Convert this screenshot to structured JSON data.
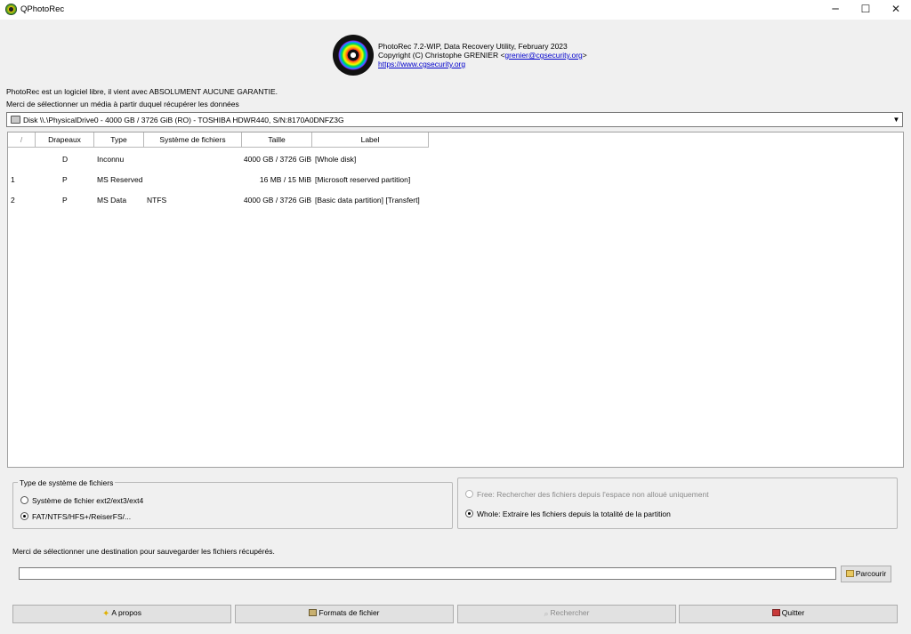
{
  "window": {
    "title": "QPhotoRec",
    "min_glyph": "─",
    "max_glyph": "☐",
    "close_glyph": "✕"
  },
  "header": {
    "version": "PhotoRec 7.2-WIP, Data Recovery Utility, February 2023",
    "copyright_prefix": "Copyright (C) Christophe GRENIER <",
    "email": "grenier@cgsecurity.org",
    "copyright_suffix": ">",
    "url": "https://www.cgsecurity.org"
  },
  "disclaimer": "PhotoRec est un logiciel libre, il vient avec ABSOLUMENT AUCUNE GARANTIE.",
  "select_prompt": "Merci de sélectionner un média à partir duquel récupérer les données",
  "disk_combo": {
    "selected": "Disk \\\\.\\PhysicalDrive0 - 4000 GB / 3726 GiB (RO) - TOSHIBA HDWR440, S/N:8170A0DNFZ3G",
    "arrow": "▼"
  },
  "table": {
    "columns": [
      "/",
      "Drapeaux",
      "Type",
      "Système de fichiers",
      "Taille",
      "Label"
    ],
    "rows": [
      {
        "num": "",
        "flag": "D",
        "type": "Inconnu",
        "fs": "",
        "size": "4000 GB / 3726 GiB",
        "label": "[Whole disk]"
      },
      {
        "num": "1",
        "flag": "P",
        "type": "MS Reserved",
        "fs": "",
        "size": "16 MB / 15 MiB",
        "label": "[Microsoft reserved partition]"
      },
      {
        "num": "2",
        "flag": "P",
        "type": "MS Data",
        "fs": "NTFS",
        "size": "4000 GB / 3726 GiB",
        "label": "[Basic data partition] [Transfert]"
      }
    ]
  },
  "fs_group": {
    "title": "Type de système de fichiers",
    "options": [
      {
        "label": "Système de fichier ext2/ext3/ext4",
        "checked": false
      },
      {
        "label": "FAT/NTFS/HFS+/ReiserFS/...",
        "checked": true
      }
    ]
  },
  "scan_group": {
    "options": [
      {
        "label": "Free: Rechercher des fichiers depuis l'espace non alloué uniquement",
        "checked": false,
        "enabled": false
      },
      {
        "label": "Whole: Extraire les fichiers depuis la totalité de la partition",
        "checked": true,
        "enabled": true
      }
    ]
  },
  "destination": {
    "label": "Merci de sélectionner une destination pour sauvegarder les fichiers récupérés.",
    "value": "",
    "browse_label": "Parcourir"
  },
  "buttons": {
    "about": "A propos",
    "formats": "Formats de fichier",
    "search": "Rechercher",
    "quit": "Quitter"
  },
  "colors": {
    "background": "#f0f0f0",
    "link": "#0000cc",
    "disabled_text": "#8a8a8a"
  }
}
